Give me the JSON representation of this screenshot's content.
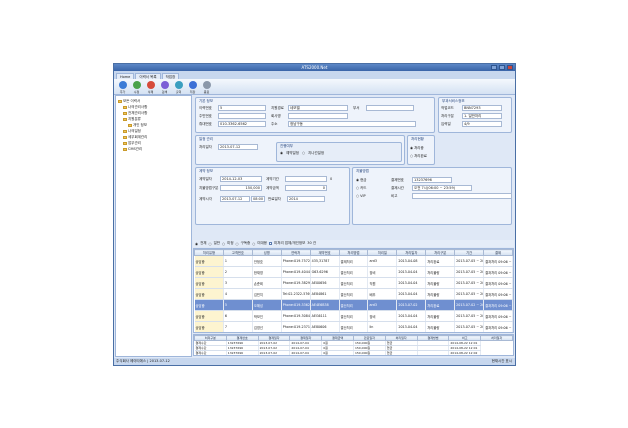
{
  "window": {
    "title": "ATS2000.Net"
  },
  "menu_tabs": [
    "Home",
    "이력서 목록",
    "작업창"
  ],
  "toolbar": [
    {
      "label": "추가",
      "color": "#3b7bd6",
      "icon": "add-icon"
    },
    {
      "label": "수정",
      "color": "#4aa34a",
      "icon": "edit-icon"
    },
    {
      "label": "삭제",
      "color": "#d64b3b",
      "icon": "delete-icon"
    },
    {
      "label": "검색",
      "color": "#7b5ed6",
      "icon": "search-icon"
    },
    {
      "label": "출력",
      "color": "#3a9fc0",
      "icon": "print-icon"
    },
    {
      "label": "저장",
      "color": "#3b6fd6",
      "icon": "save-icon"
    },
    {
      "label": "종료",
      "color": "#8b98aa",
      "icon": "exit-icon"
    }
  ],
  "tree": [
    "모든 이력서",
    "나의관리사항",
    "전체관리사항",
    "지원분류",
    "개인 정보",
    "나의일정",
    "세무회계관리",
    "업무관리",
    "CMS관리"
  ],
  "basic": {
    "header": "기본 정보",
    "name_label": "이력번호",
    "name_value": "5",
    "name2_label": "지원경로",
    "name2_value": "네모엘",
    "dept_label": "부서",
    "dept_value": "",
    "birth_label": "주민번호",
    "birth_value": "",
    "company_label": "회사명",
    "company_value": "",
    "phone_label": "휴대번호",
    "phone_value": "010-3362-6562",
    "addr_label": "주소",
    "addr_value": "정남구동"
  },
  "right_info": {
    "header": "부과서비스정보",
    "a_label": "작업코드",
    "a_value": "BNN7293",
    "b_label": "처리구분",
    "b_value": "1. 일반처리",
    "c_label": "입력일",
    "c_value": "4/9"
  },
  "schedule": {
    "header": "일정 관리",
    "date_label": "처리일자",
    "date_value": "2013-07-12",
    "group_label": "진행여부",
    "opt1": "예약일정",
    "opt2": "지나간일정"
  },
  "status_box": {
    "header": "처리현황",
    "opt1": "처리중",
    "opt2": "처리완료"
  },
  "contract": {
    "header": "계약 정보",
    "start_label": "계약일자",
    "start_value": "2014-12-03",
    "period_label": "계약기간",
    "period_value": "",
    "pay_label": "지불방법구분",
    "pay_value": "",
    "amount_label": "계약금액",
    "amount_value": "150,000",
    "deposit_label": "계약금액",
    "deposit_value": "0",
    "total_label": "계약금액",
    "total_value": "0",
    "time_label": "계약시각",
    "time_value": "2013-07-12",
    "time2_value": "08:00",
    "expire_label": "만료일자",
    "expire_value": "2014"
  },
  "pay_method": {
    "header": "지불방법",
    "opt1": "현금",
    "opt2": "카드",
    "opt3": "VIP",
    "acct_label": "결제번호",
    "acct_value": "13237696",
    "time_label": "결제시간",
    "time_value": "오전 7시(06:00 ~ 23:59)",
    "memo_label": "비고",
    "memo_value": ""
  },
  "filter": {
    "items": [
      "전체",
      "일반",
      "미정",
      "구독중",
      "미대응"
    ],
    "extra": "미처리 업체/개인정보",
    "count": "30 건"
  },
  "table1": {
    "columns": [
      "처리유형",
      "고객번호",
      "성명",
      "연락처",
      "계약번호",
      "처리방법",
      "처리일",
      "처리일자",
      "처리구분",
      "기간",
      "결제"
    ],
    "rows": [
      {
        "type": "상담중",
        "no": "1",
        "name": "안정호",
        "tel": "Phone:019-7572-2296",
        "c": "435,31787",
        "m": "결제처리",
        "d": "ard3",
        "dt": "2013-04-08",
        "s": "처리완료",
        "p": "2013-07-05 ~ 2013-12-31",
        "r": "결과처리 09:06 ~ 23:59"
      },
      {
        "type": "상담중",
        "no": "2",
        "name": "한재영",
        "tel": "Phone:019-4044-0297",
        "c": "G63.6296",
        "m": "결산처리",
        "d": "장비",
        "dt": "2013-04-04",
        "s": "처리불량",
        "p": "2013-07-05 ~ 2013-12-31",
        "r": "결과처리 09:06 ~ 23:59"
      },
      {
        "type": "상담중",
        "no": "3",
        "name": "손준희",
        "tel": "Phone:019-3829-0030",
        "c": "AE00656",
        "m": "결산처리",
        "d": "직원",
        "dt": "2013-04-04",
        "s": "처리불량",
        "p": "2013-07-05 ~ 2013-12-31",
        "r": "결과처리 09:06 ~ 23:59"
      },
      {
        "type": "상담중",
        "no": "4",
        "name": "김민지",
        "tel": "Tel:02-2322-5769",
        "c": "AE84861",
        "m": "결산처리",
        "d": "배추",
        "dt": "2013-04-04",
        "s": "처리불량",
        "p": "2013-07-05 ~ 2013-12-31",
        "r": "결과처리 09:06 ~ 23:59"
      },
      {
        "type": "상담중",
        "no": "5",
        "name": "오해성",
        "tel": "Phone:019-3362-6562",
        "c": "AE4E6B38",
        "m": "결산처리",
        "d": "ard3",
        "dt": "2013-07-02",
        "s": "처리완료",
        "p": "2013-07-02 ~ 2013-12-31",
        "r": "결과처리 09:06 ~ 23:59"
      },
      {
        "type": "상담중",
        "no": "6",
        "name": "박보인",
        "tel": "Phone:019-3084-8270",
        "c": "AEG6111",
        "m": "결산처리",
        "d": "장비",
        "dt": "2013-04-04",
        "s": "처리불량",
        "p": "2013-07-05 ~ 2013-12-31",
        "r": "결과처리 09:06 ~ 23:59"
      },
      {
        "type": "상담중",
        "no": "7",
        "name": "김영선",
        "tel": "Phone:019-2371-0445",
        "c": "AE80606",
        "m": "결산처리",
        "d": "lin",
        "dt": "2013-04-04",
        "s": "처리불량",
        "p": "2013-07-05 ~ 2013-12-31",
        "r": "결과처리 09:06 ~ 23:59"
      },
      {
        "type": "상담중",
        "no": "8",
        "name": "이 조",
        "tel": "Tel:02-396-0565",
        "c": "459,6948",
        "m": "결산처리",
        "d": "",
        "dt": "2013-04-04",
        "s": "처리불량",
        "p": "2013-07-05",
        "r": "결과처리"
      }
    ]
  },
  "table2": {
    "columns": [
      "처리구분",
      "결제번호",
      "결제일자",
      "결제일자",
      "결제금액",
      "만료일자",
      "처리일자",
      "결제방법",
      "비고",
      "처리일자"
    ],
    "rows": [
      [
        "결제수단",
        "13237696",
        "2013-07-02",
        "2014-07-04",
        "0원",
        "150,000원",
        "현금",
        "",
        "2014-08-22 12:01"
      ],
      [
        "결제수단",
        "13237696",
        "2013-07-02",
        "2014-07-04",
        "0원",
        "150,000원",
        "현금",
        "",
        "2014-08-22 12:01"
      ],
      [
        "결제수단",
        "13237696",
        "2013-07-02",
        "2014-07-04",
        "0원",
        "150,000원",
        "현금",
        "",
        "2014-08-22 12:02"
      ],
      [
        "결제수단",
        "13237696",
        "2013-07-02",
        "2014-07-04",
        "0원",
        "150,000원",
        "현금",
        "",
        "2014-08-22 12:07"
      ]
    ],
    "footer": "1,050,000"
  },
  "statusbar": {
    "left": "주식회사 에이티에스 | 2013-07-12",
    "right": "현재시간 표시"
  }
}
